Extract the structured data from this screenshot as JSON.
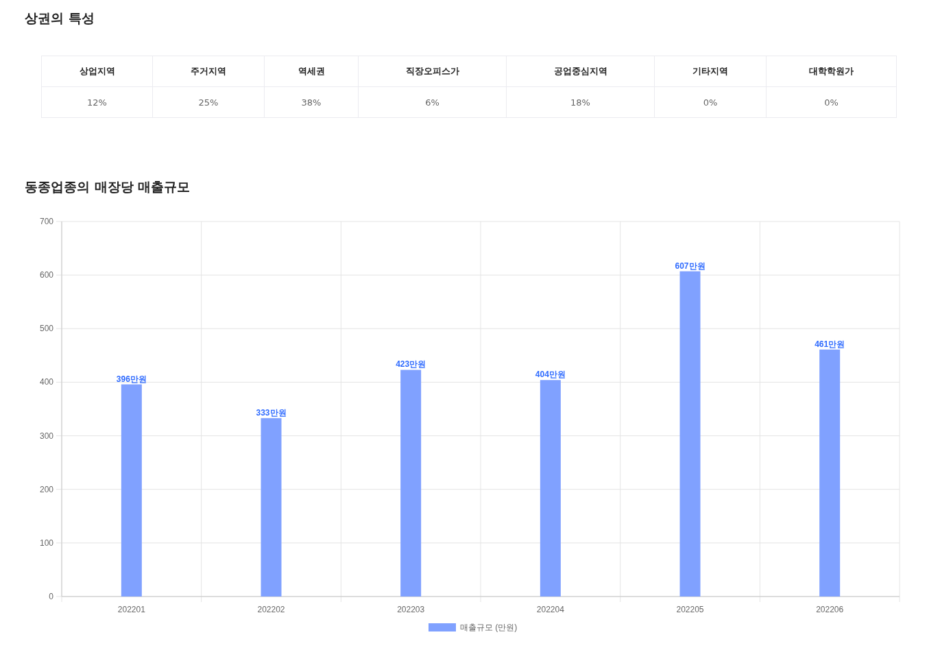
{
  "trade_area": {
    "title": "상권의 특성",
    "table": {
      "columns": [
        "상업지역",
        "주거지역",
        "역세권",
        "직장오피스가",
        "공업중심지역",
        "기타지역",
        "대학학원가"
      ],
      "rows": [
        [
          "12%",
          "25%",
          "38%",
          "6%",
          "18%",
          "0%",
          "0%"
        ]
      ]
    }
  },
  "sales": {
    "title": "동종업종의 매장당 매출규모",
    "chart_data": {
      "type": "bar",
      "categories": [
        "202201",
        "202202",
        "202203",
        "202204",
        "202205",
        "202206"
      ],
      "series": [
        {
          "name": "매출규모 (만원)",
          "color": "#80a1ff",
          "values": [
            396,
            333,
            423,
            404,
            607,
            461
          ]
        }
      ],
      "ylim": [
        0,
        700
      ],
      "grid": true,
      "yticks": [
        0,
        100,
        200,
        300,
        400,
        500,
        600,
        700
      ],
      "value_labels": [
        "396만원",
        "333만원",
        "423만원",
        "404만원",
        "607만원",
        "461만원"
      ]
    }
  }
}
